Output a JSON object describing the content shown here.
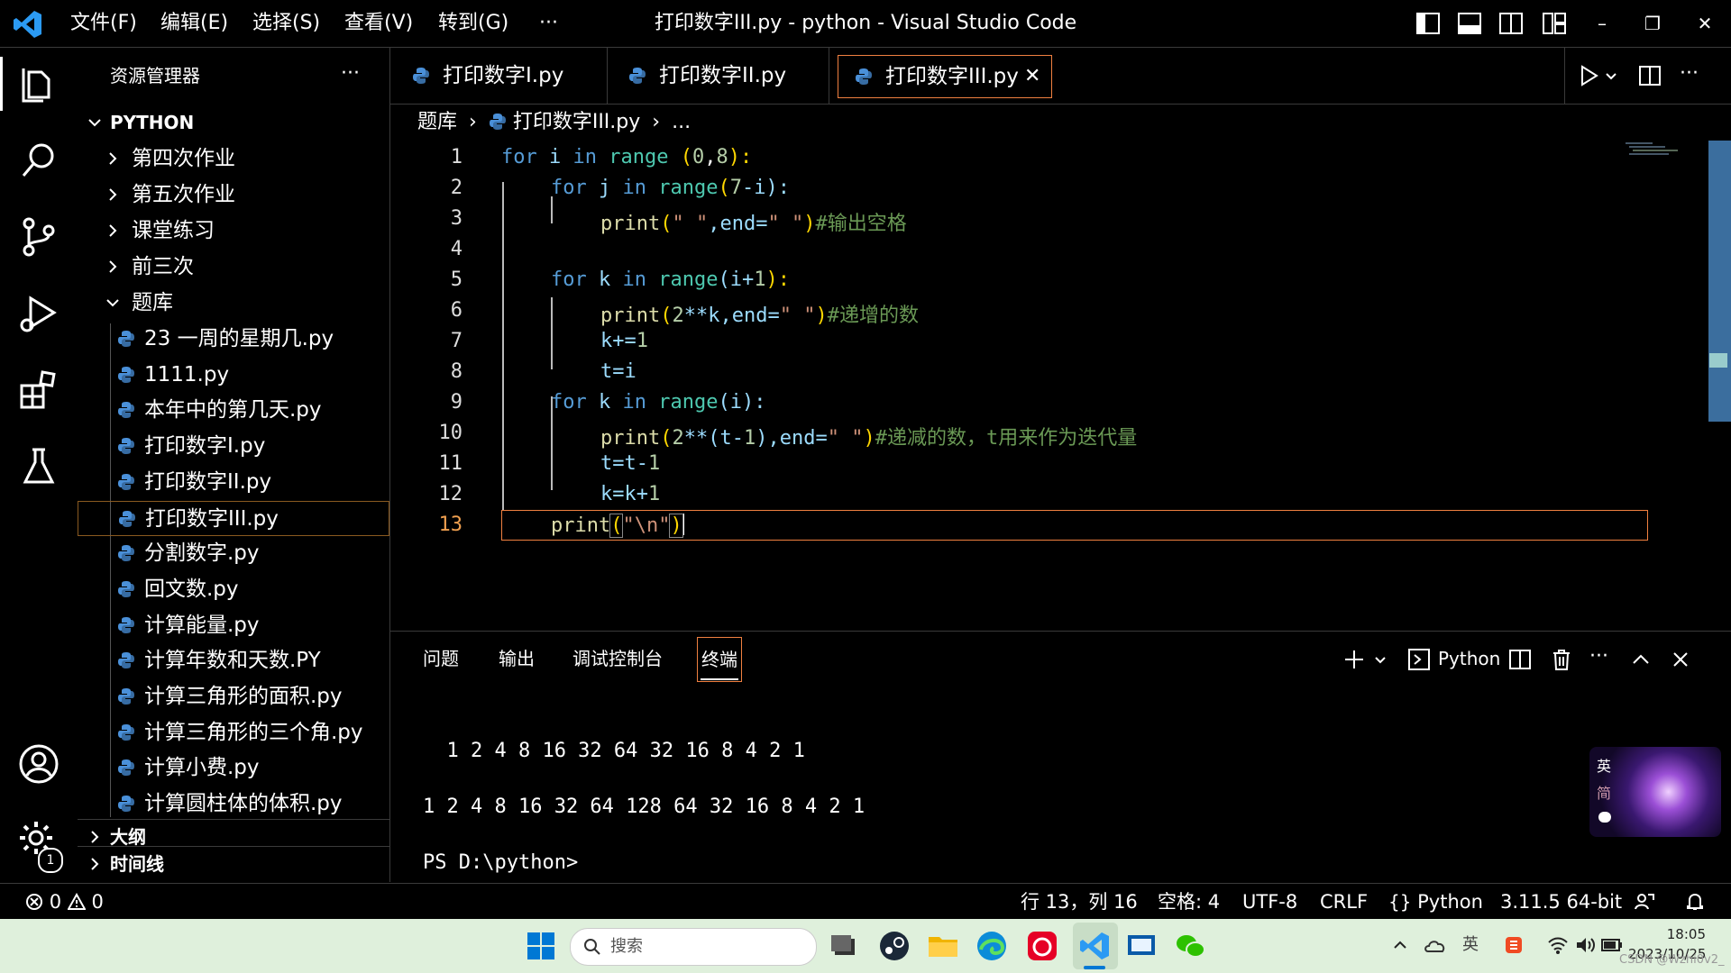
{
  "window": {
    "title": "打印数字III.py - python - Visual Studio Code",
    "menu": [
      "文件(F)",
      "编辑(E)",
      "选择(S)",
      "查看(V)",
      "转到(G)",
      "···"
    ]
  },
  "activity": {
    "settings_badge": "1"
  },
  "sidebar": {
    "header": "资源管理器",
    "more": "···",
    "root": "PYTHON",
    "folders": [
      "第四次作业",
      "第五次作业",
      "课堂练习",
      "前三次"
    ],
    "open_folder": "题库",
    "files": [
      "23 一周的星期几.py",
      "1111.py",
      "本年中的第几天.py",
      "打印数字I.py",
      "打印数字II.py",
      "打印数字III.py",
      "分割数字.py",
      "回文数.py",
      "计算能量.py",
      "计算年数和天数.PY",
      "计算三角形的面积.py",
      "计算三角形的三个角.py",
      "计算小费.py",
      "计算圆柱体的体积.py"
    ],
    "outline": "大纲",
    "timeline": "时间线"
  },
  "tabs": [
    {
      "label": "打印数字I.py"
    },
    {
      "label": "打印数字II.py"
    },
    {
      "label": "打印数字III.py",
      "close": "✕"
    }
  ],
  "breadcrumb": {
    "folder": "题库",
    "file": "打印数字III.py",
    "more": "..."
  },
  "code": {
    "line_numbers": [
      "1",
      "2",
      "3",
      "4",
      "5",
      "6",
      "7",
      "8",
      "9",
      "10",
      "11",
      "12",
      "13"
    ],
    "tokens": {
      "l1": [
        "for",
        " i ",
        "in",
        " ",
        "range",
        " (",
        "0",
        ",",
        "8",
        "):"
      ],
      "l2": [
        "for",
        " j ",
        "in",
        " ",
        "range",
        "(",
        "7",
        "-i):"
      ],
      "l3": [
        "print",
        "(",
        "\" \"",
        ",end=",
        "\" \"",
        ")",
        "#输出空格"
      ],
      "l5": [
        "for",
        " k ",
        "in",
        " ",
        "range",
        "(i+",
        "1",
        "):"
      ],
      "l6": [
        "print",
        "(",
        "2",
        "**k,end=",
        "\" \"",
        ")",
        "#递增的数"
      ],
      "l7": [
        "k+=",
        "1"
      ],
      "l8": [
        "t=i"
      ],
      "l9": [
        "for",
        " k ",
        "in",
        " ",
        "range",
        "(i):"
      ],
      "l10": [
        "print",
        "(",
        "2",
        "**(t-",
        "1",
        "),end=",
        "\" \"",
        ")",
        "#递减的数，t用来作为迭代量"
      ],
      "l11": [
        "t=t-",
        "1"
      ],
      "l12": [
        "k=k+",
        "1"
      ],
      "l13": [
        "print",
        "(",
        "\"\\n\"",
        ")"
      ]
    }
  },
  "panel": {
    "tabs": [
      "问题",
      "输出",
      "调试控制台",
      "终端"
    ],
    "active_tab": "终端",
    "terminal_profile": "Python",
    "lines": [
      "  1 2 4 8 16 32 64 32 16 8 4 2 1",
      "1 2 4 8 16 32 64 128 64 32 16 8 4 2 1",
      "PS D:\\python>"
    ],
    "ime": {
      "lang": "英",
      "mode": "简"
    }
  },
  "status": {
    "errors": "0",
    "warnings": "0",
    "position": "行 13，列 16",
    "spaces": "空格: 4",
    "encoding": "UTF-8",
    "eol": "CRLF",
    "language": "Python",
    "interpreter": "3.11.5 64-bit"
  },
  "taskbar": {
    "search_placeholder": "搜索",
    "time": "18:05",
    "date": "2023/10/25",
    "watermark": "CSDN @Wzhi0v2_",
    "tray_ime": "英"
  },
  "colors": {
    "keyword": "#569cd6",
    "builtin": "#4ec9b0",
    "string": "#ce9178",
    "comment": "#6a9955",
    "number": "#b5cea8",
    "function": "#dcdcaa",
    "variable": "#9cdcfe",
    "active_border": "#f08040",
    "accent_blue": "#0078d4"
  }
}
